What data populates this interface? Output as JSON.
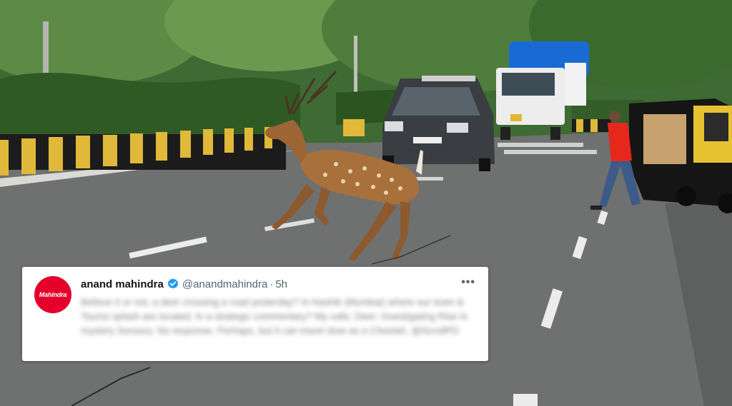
{
  "tweet": {
    "display_name": "anand mahindra",
    "handle": "@anandmahindra",
    "separator": "·",
    "time": "5h",
    "more_label": "•••",
    "avatar_text": "Mahindra",
    "body_text": "Believe it or not, a deer crossing a road yesterday? In Nashik (Mumbai) where our team & Tourist splash are located. In a strategic commentary? My calls: Deer: Investigating Rise in mystery Sensory. No response. Perhaps, but it can travel slow as a Cheetah. @ScrollPD",
    "verified_icon": "verified-badge-icon",
    "colors": {
      "brand_red": "#e4002b",
      "verified_blue": "#1d9bf0"
    }
  }
}
